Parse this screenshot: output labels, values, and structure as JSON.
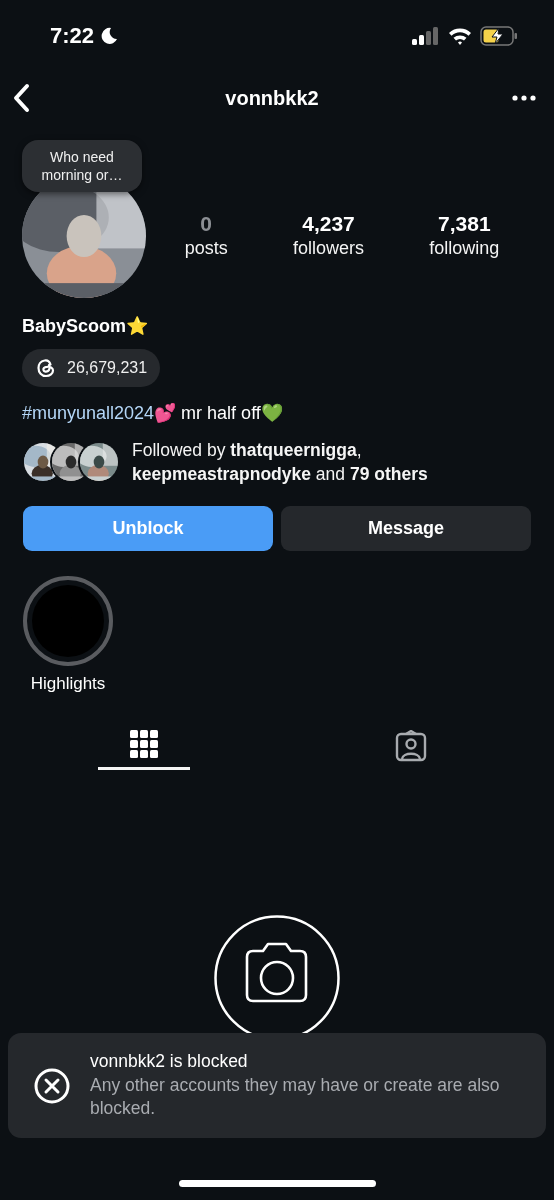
{
  "status_bar": {
    "time": "7:22"
  },
  "nav": {
    "title": "vonnbkk2"
  },
  "profile": {
    "note": "Who need morning or…",
    "stats": [
      {
        "value": "0",
        "label": "posts",
        "dimmed": true
      },
      {
        "value": "4,237",
        "label": "followers",
        "dimmed": false
      },
      {
        "value": "7,381",
        "label": "following",
        "dimmed": false
      }
    ]
  },
  "name": "BabyScoom⭐",
  "threads_badge": {
    "count": "26,679,231"
  },
  "bio": {
    "hashtag": "#munyunall2024",
    "text": "💕 mr half off💚"
  },
  "followed_by": {
    "text": "Followed by **thatqueernigga**, **keepmeastrapnodyke** and **79 others**"
  },
  "buttons": [
    {
      "label": "Unblock",
      "kind": "primary"
    },
    {
      "label": "Message",
      "kind": "secondary"
    }
  ],
  "highlights": [
    {
      "label": "Highlights"
    }
  ],
  "tabs": [
    {
      "kind": "grid",
      "selected": true
    },
    {
      "kind": "tagged",
      "selected": false
    }
  ],
  "toast": {
    "title": "vonnbkk2 is blocked",
    "message": "Any other accounts they may have or create are also blocked."
  }
}
